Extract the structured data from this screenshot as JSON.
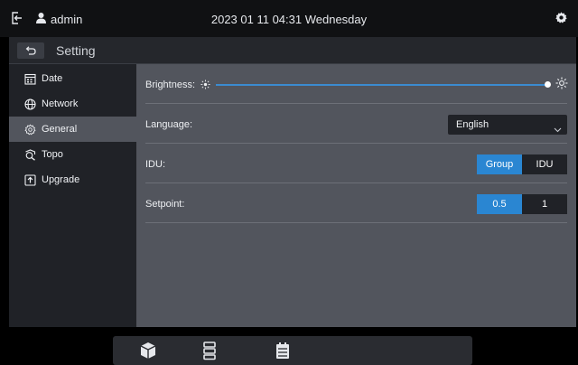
{
  "status_bar": {
    "username": "admin",
    "datetime": "2023 01 11 04:31 Wednesday",
    "icons": [
      "logout-icon",
      "user-icon",
      "gear-icon"
    ]
  },
  "title_bar": {
    "title": "Setting",
    "back_icon": "back-arrow-icon"
  },
  "sidebar": {
    "items": [
      {
        "label": "Date",
        "icon": "calendar-icon",
        "active": false
      },
      {
        "label": "Network",
        "icon": "globe-icon",
        "active": false
      },
      {
        "label": "General",
        "icon": "gear-icon",
        "active": true
      },
      {
        "label": "Topo",
        "icon": "topology-icon",
        "active": false
      },
      {
        "label": "Upgrade",
        "icon": "upgrade-icon",
        "active": false
      }
    ]
  },
  "general": {
    "brightness": {
      "label": "Brightness:",
      "value_fraction": 0.99
    },
    "language": {
      "label": "Language:",
      "selected": "English"
    },
    "idu": {
      "label": "IDU:",
      "options": [
        "Group",
        "IDU"
      ],
      "selected": "Group"
    },
    "setpoint": {
      "label": "Setpoint:",
      "options": [
        "0.5",
        "1"
      ],
      "selected": "0.5"
    }
  },
  "dock": {
    "icons": [
      "cube-icon",
      "unit-list-icon",
      "schedule-icon"
    ]
  },
  "colors": {
    "accent": "#2a86d2",
    "panel": "#52555d",
    "sidebar": "#202227",
    "status_bar": "#101113"
  }
}
